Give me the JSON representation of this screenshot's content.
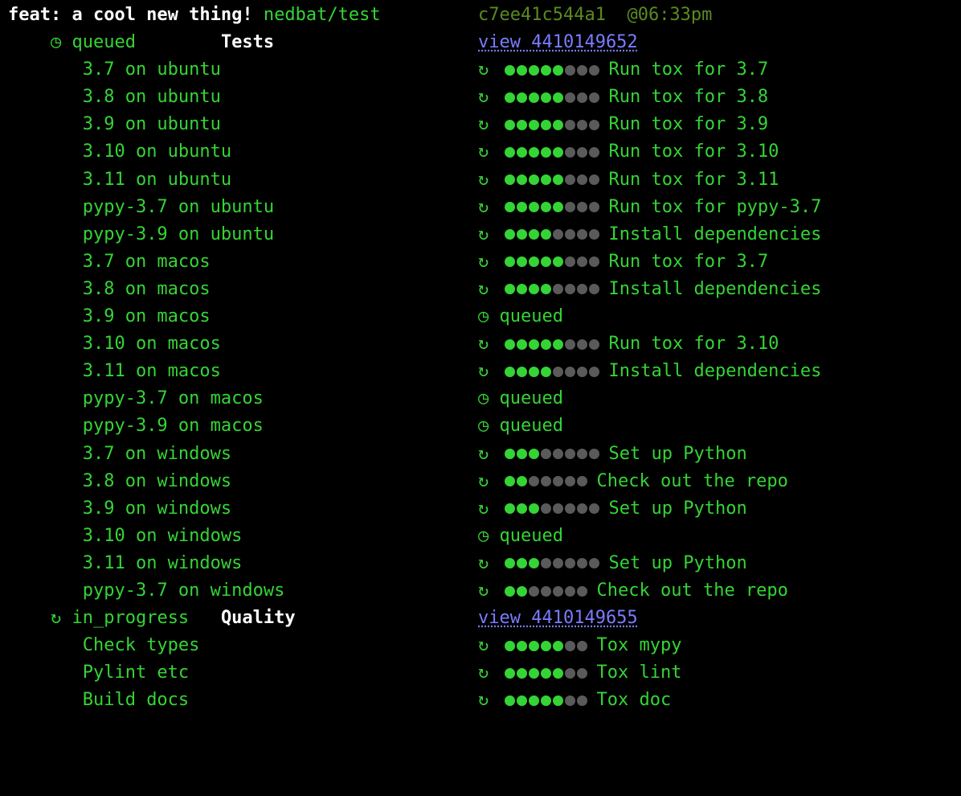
{
  "header": {
    "title": "feat: a cool new thing!",
    "repo": "nedbat/test",
    "commit": "c7ee41c544a1",
    "time": "@06:33pm"
  },
  "icons": {
    "queued": "◷",
    "spinner": "↻"
  },
  "status_labels": {
    "queued": "queued",
    "in_progress": "in_progress"
  },
  "view_prefix": "view ",
  "dot_total": 8,
  "workflows": [
    {
      "status_icon": "queued",
      "status": "queued",
      "name": "Tests",
      "run_id": "4410149652",
      "jobs": [
        {
          "name": "3.7 on ubuntu",
          "kind": "progress",
          "done": 5,
          "step": "Run tox for 3.7"
        },
        {
          "name": "3.8 on ubuntu",
          "kind": "progress",
          "done": 5,
          "step": "Run tox for 3.8"
        },
        {
          "name": "3.9 on ubuntu",
          "kind": "progress",
          "done": 5,
          "step": "Run tox for 3.9"
        },
        {
          "name": "3.10 on ubuntu",
          "kind": "progress",
          "done": 5,
          "step": "Run tox for 3.10"
        },
        {
          "name": "3.11 on ubuntu",
          "kind": "progress",
          "done": 5,
          "step": "Run tox for 3.11"
        },
        {
          "name": "pypy-3.7 on ubuntu",
          "kind": "progress",
          "done": 5,
          "step": "Run tox for pypy-3.7"
        },
        {
          "name": "pypy-3.9 on ubuntu",
          "kind": "progress",
          "done": 4,
          "step": "Install dependencies"
        },
        {
          "name": "3.7 on macos",
          "kind": "progress",
          "done": 5,
          "step": "Run tox for 3.7"
        },
        {
          "name": "3.8 on macos",
          "kind": "progress",
          "done": 4,
          "step": "Install dependencies"
        },
        {
          "name": "3.9 on macos",
          "kind": "queued"
        },
        {
          "name": "3.10 on macos",
          "kind": "progress",
          "done": 5,
          "step": "Run tox for 3.10"
        },
        {
          "name": "3.11 on macos",
          "kind": "progress",
          "done": 4,
          "step": "Install dependencies"
        },
        {
          "name": "pypy-3.7 on macos",
          "kind": "queued"
        },
        {
          "name": "pypy-3.9 on macos",
          "kind": "queued"
        },
        {
          "name": "3.7 on windows",
          "kind": "progress",
          "done": 3,
          "step": "Set up Python"
        },
        {
          "name": "3.8 on windows",
          "kind": "progress7",
          "done": 2,
          "step": "Check out the repo"
        },
        {
          "name": "3.9 on windows",
          "kind": "progress",
          "done": 3,
          "step": "Set up Python"
        },
        {
          "name": "3.10 on windows",
          "kind": "queued"
        },
        {
          "name": "3.11 on windows",
          "kind": "progress",
          "done": 3,
          "step": "Set up Python"
        },
        {
          "name": "pypy-3.7 on windows",
          "kind": "progress7",
          "done": 2,
          "step": "Check out the repo"
        }
      ]
    },
    {
      "status_icon": "spinner",
      "status": "in_progress",
      "name": "Quality",
      "run_id": "4410149655",
      "jobs": [
        {
          "name": "Check types",
          "kind": "progress7",
          "done": 5,
          "step": "Tox mypy"
        },
        {
          "name": "Pylint etc",
          "kind": "progress7",
          "done": 5,
          "step": "Tox lint"
        },
        {
          "name": "Build docs",
          "kind": "progress7",
          "done": 5,
          "step": "Tox doc"
        }
      ]
    }
  ]
}
